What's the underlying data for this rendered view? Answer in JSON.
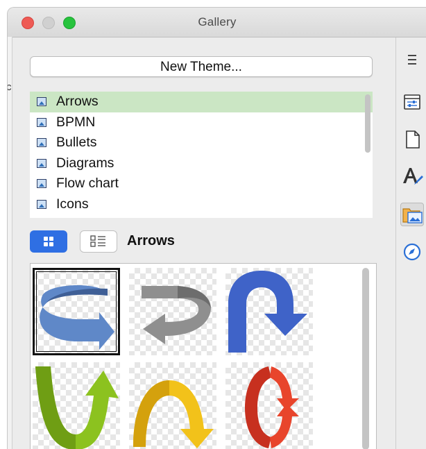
{
  "window": {
    "title": "Gallery"
  },
  "left_panel": {
    "clipped_char": "c"
  },
  "gallery": {
    "new_theme_label": "New Theme...",
    "themes": [
      {
        "label": "Arrows",
        "selected": true
      },
      {
        "label": "BPMN",
        "selected": false
      },
      {
        "label": "Bullets",
        "selected": false
      },
      {
        "label": "Diagrams",
        "selected": false
      },
      {
        "label": "Flow chart",
        "selected": false
      },
      {
        "label": "Icons",
        "selected": false
      }
    ],
    "view_modes": [
      {
        "name": "icon-view",
        "active": true
      },
      {
        "name": "detailed-view",
        "active": false
      }
    ],
    "current_theme_label": "Arrows",
    "items": [
      {
        "name": "circular-arrow-blue-icon",
        "selected": true
      },
      {
        "name": "circular-arrow-gray-icon",
        "selected": false
      },
      {
        "name": "u-turn-arrow-blue-icon",
        "selected": false
      },
      {
        "name": "u-arrow-green-icon",
        "selected": false
      },
      {
        "name": "arch-arrow-yellow-icon",
        "selected": false
      },
      {
        "name": "circular-arrows-red-icon",
        "selected": false
      }
    ]
  },
  "sidebar": {
    "buttons": [
      {
        "name": "sidebar-menu-icon",
        "active": false
      },
      {
        "name": "properties-icon",
        "active": false
      },
      {
        "name": "page-icon",
        "active": false
      },
      {
        "name": "styles-icon",
        "active": false
      },
      {
        "name": "gallery-icon",
        "active": true
      },
      {
        "name": "navigator-icon",
        "active": false
      }
    ]
  },
  "colors": {
    "selection_green": "#cbe6c4",
    "accent_blue": "#2f6fe3",
    "close_red": "#ee5b55",
    "zoom_green": "#27c33d"
  }
}
